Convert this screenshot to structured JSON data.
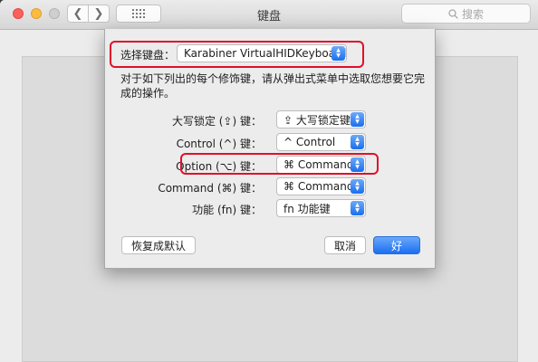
{
  "window": {
    "title": "键盘",
    "search_placeholder": "搜索"
  },
  "dialog": {
    "keyboard_select_label": "选择键盘：",
    "keyboard_select_value": "Karabiner VirtualHIDKeyboard",
    "description": "对于如下列出的每个修饰键，请从弹出式菜单中选取您想要它完成的操作。",
    "rows": [
      {
        "label": "大写锁定 (⇪) 键：",
        "value": "⇪ 大写锁定键"
      },
      {
        "label": "Control (^) 键：",
        "value": "^ Control"
      },
      {
        "label": "Option (⌥) 键：",
        "value": "⌘ Command"
      },
      {
        "label": "Command (⌘) 键：",
        "value": "⌘ Command"
      },
      {
        "label": "功能 (fn) 键：",
        "value": "fn 功能键"
      }
    ],
    "restore_defaults_label": "恢复成默认",
    "cancel_label": "取消",
    "ok_label": "好"
  },
  "colors": {
    "accent": "#1c6ff0",
    "annotation": "#e0102a"
  },
  "icons": {
    "search": "search-icon",
    "back": "chevron-left-icon",
    "forward": "chevron-right-icon",
    "grid": "grid-icon",
    "popup_arrows": "up-down-arrows-icon"
  }
}
